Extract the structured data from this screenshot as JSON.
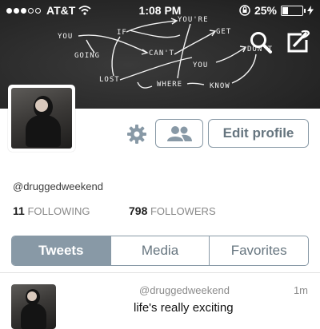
{
  "status_bar": {
    "carrier": "AT&T",
    "time": "1:08 PM",
    "battery": "25%",
    "battery_level": 0.25
  },
  "header": {
    "doodle_words": [
      "YOU",
      "IF",
      "YOU'RE",
      "GET",
      "GOING",
      "CAN'T",
      "YOU",
      "DON'T",
      "LOST",
      "WHERE",
      "KNOW"
    ],
    "search_icon": "search-icon",
    "compose_icon": "compose-icon"
  },
  "profile": {
    "handle": "@druggedweekend",
    "following_count": "11",
    "following_label": "FOLLOWING",
    "followers_count": "798",
    "followers_label": "FOLLOWERS",
    "edit_label": "Edit profile",
    "settings_icon": "gear-icon",
    "people_icon": "people-icon"
  },
  "tabs": [
    {
      "label": "Tweets",
      "active": true
    },
    {
      "label": "Media",
      "active": false
    },
    {
      "label": "Favorites",
      "active": false
    }
  ],
  "tweet": {
    "handle": "@druggedweekend",
    "time": "1m",
    "text": "life's really exciting"
  },
  "colors": {
    "accent": "#8899a6",
    "header_bg": "#2b2b2b"
  }
}
